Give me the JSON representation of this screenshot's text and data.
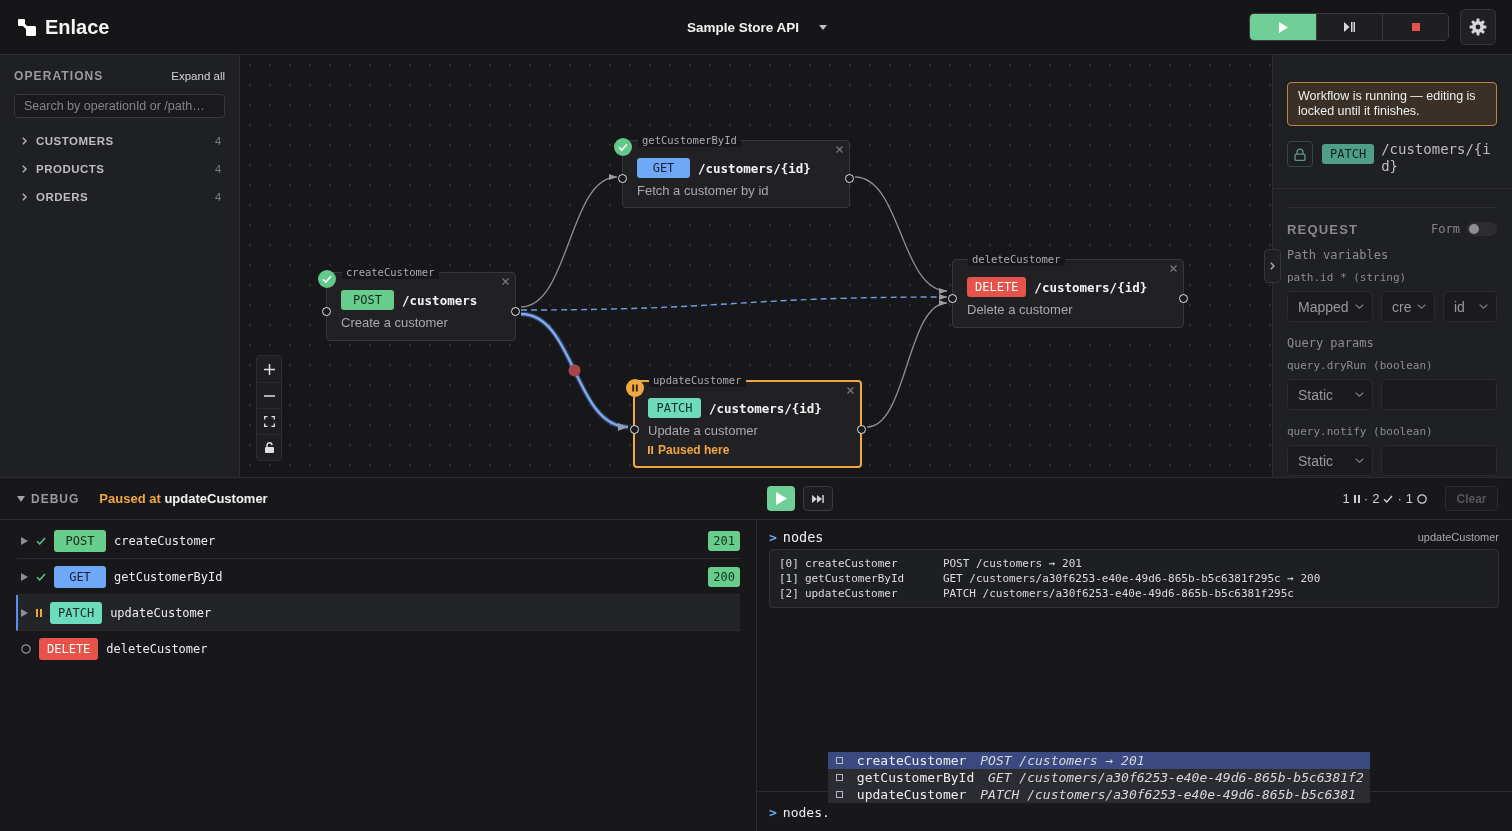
{
  "app": {
    "name": "Enlace"
  },
  "header": {
    "project": "Sample Store API",
    "run_controls": [
      {
        "kind": "run",
        "active": true
      },
      {
        "kind": "step",
        "active": false
      },
      {
        "kind": "stop",
        "active": false
      }
    ]
  },
  "sidebar": {
    "title": "OPERATIONS",
    "expand_all": "Expand all",
    "search": {
      "placeholder": "Search by operationId or /path…"
    },
    "groups": [
      {
        "label": "CUSTOMERS",
        "count": "4",
        "expanded": false
      },
      {
        "label": "PRODUCTS",
        "count": "4",
        "expanded": false
      },
      {
        "label": "ORDERS",
        "count": "4",
        "expanded": false
      }
    ]
  },
  "canvas": {
    "nodes": [
      {
        "operation": "getCustomerById",
        "kind": "done",
        "method": {
          "label": "GET",
          "color": "#6ea8f7"
        },
        "path": "/customers/{id}",
        "description": "Fetch a customer by id"
      },
      {
        "operation": "createCustomer",
        "kind": "done",
        "method": {
          "label": "POST",
          "color": "#67cd8c"
        },
        "path": "/customers",
        "description": "Create a customer"
      },
      {
        "operation": "deleteCustomer",
        "kind": "idle",
        "method": {
          "label": "DELETE",
          "color": "#e5534b"
        },
        "path": "/customers/{id}",
        "description": "Delete a customer"
      },
      {
        "operation": "updateCustomer",
        "kind": "paused",
        "method": {
          "label": "PATCH",
          "color": "#6ddcbd"
        },
        "path": "/customers/{id}",
        "description": "Update a customer",
        "note": "Paused here"
      }
    ],
    "edges": [
      {
        "kind": "flow",
        "breakpoint": false
      },
      {
        "kind": "flow",
        "breakpoint": false
      },
      {
        "kind": "data",
        "breakpoint": false
      },
      {
        "kind": "active",
        "breakpoint": true
      },
      {
        "kind": "flow",
        "breakpoint": false
      }
    ]
  },
  "inspector": {
    "notice": "Workflow is running — editing is locked until it finishes.",
    "method": {
      "label": "PATCH",
      "color": "#4f9e88"
    },
    "path": "/customers/{id}",
    "request": {
      "title": "REQUEST",
      "mode_label": "Form",
      "mode_on": false,
      "sections": [
        {
          "title": "Path variables",
          "params": [
            {
              "label": "path.id * (string)",
              "kind": "mapped",
              "source": "Mapped",
              "node": "cre",
              "field": "id"
            }
          ]
        },
        {
          "title": "Query params",
          "params": [
            {
              "label": "query.dryRun (boolean)",
              "kind": "static",
              "source": "Static"
            },
            {
              "label": "query.notify (boolean)",
              "kind": "static",
              "source": "Static"
            }
          ]
        }
      ]
    }
  },
  "debug": {
    "title": "DEBUG",
    "status_prefix": "Paused at",
    "status_target": "updateCustomer",
    "summary": {
      "separator": "·",
      "items": [
        {
          "count": "1",
          "kind": "paused"
        },
        {
          "count": "2",
          "kind": "done"
        },
        {
          "count": "1",
          "kind": "pending"
        }
      ]
    },
    "clear": {
      "label": "Clear",
      "disabled": true
    },
    "steps": [
      {
        "kind": "done",
        "method": {
          "label": "POST",
          "color": "#67cd8c"
        },
        "operation": "createCustomer",
        "response": "201",
        "selected": false
      },
      {
        "kind": "done",
        "method": {
          "label": "GET",
          "color": "#6ea8f7"
        },
        "operation": "getCustomerById",
        "response": "200",
        "selected": false
      },
      {
        "kind": "paused",
        "method": {
          "label": "PATCH",
          "color": "#6ddcbd"
        },
        "operation": "updateCustomer",
        "selected": true
      },
      {
        "kind": "pending",
        "method": {
          "label": "DELETE",
          "color": "#e5534b"
        },
        "operation": "deleteCustomer",
        "selected": false
      }
    ],
    "console": {
      "prompt": ">",
      "command": "nodes",
      "context": "updateCustomer",
      "output": [
        {
          "index": "[0]",
          "name": "createCustomer",
          "detail": "POST /customers → 201"
        },
        {
          "index": "[1]",
          "name": "getCustomerById",
          "detail": "GET /customers/a30f6253-e40e-49d6-865b-b5c6381f295c → 200"
        },
        {
          "index": "[2]",
          "name": "updateCustomer",
          "detail": "PATCH /customers/a30f6253-e40e-49d6-865b-b5c6381f295c"
        }
      ],
      "completions": [
        {
          "name": "createCustomer",
          "detail": "POST /customers → 201",
          "selected": true
        },
        {
          "name": "getCustomerById",
          "detail": "GET /customers/a30f6253-e40e-49d6-865b-b5c6381f2",
          "selected": false
        },
        {
          "name": "updateCustomer",
          "detail": "PATCH /customers/a30f6253-e40e-49d6-865b-b5c6381",
          "selected": false
        }
      ],
      "input": {
        "prompt": ">",
        "value": "nodes."
      }
    }
  }
}
